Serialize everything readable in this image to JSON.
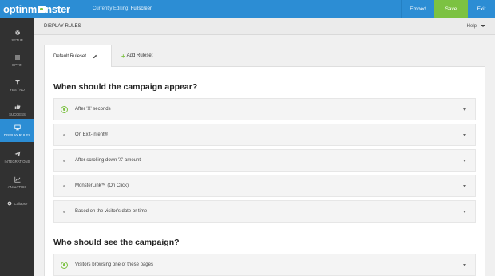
{
  "topbar": {
    "logo_left": "optinm",
    "logo_right": "nster",
    "editing_label": "Currently Editing:",
    "editing_value": "Fullscreen",
    "embed_label": "Embed",
    "save_label": "Save",
    "exit_label": "Exit",
    "colors": {
      "bar": "#2c8dd4",
      "save": "#7cc242"
    }
  },
  "sidebar": {
    "items": [
      {
        "label": "SETUP",
        "icon": "gear-icon"
      },
      {
        "label": "OPTIN",
        "icon": "menu-lines-icon"
      },
      {
        "label": "YES / NO",
        "icon": "filter-icon"
      },
      {
        "label": "SUCCESS",
        "icon": "thumbs-up-icon"
      },
      {
        "label": "DISPLAY RULES",
        "icon": "monitor-icon"
      },
      {
        "label": "INTEGRATIONS",
        "icon": "paper-plane-icon"
      },
      {
        "label": "ANALYTICS",
        "icon": "line-chart-icon"
      }
    ],
    "collapse_label": "Collapse",
    "active": "DISPLAY RULES"
  },
  "header": {
    "title": "DISPLAY RULES",
    "help_label": "Help"
  },
  "tabs": {
    "ruleset_label": "Default Ruleset",
    "add_label": "Add Ruleset"
  },
  "section1": {
    "heading": "When should the campaign appear?",
    "rules": [
      {
        "label": "After 'X' seconds",
        "selected": true
      },
      {
        "label": "On Exit-Intent®",
        "selected": false
      },
      {
        "label": "After scrolling down 'X' amount",
        "selected": false
      },
      {
        "label": "MonsterLink™ (On Click)",
        "selected": false
      },
      {
        "label": "Based on the visitor's date or time",
        "selected": false
      }
    ]
  },
  "section2": {
    "heading": "Who should see the campaign?",
    "rules": [
      {
        "label": "Visitors browsing one of these pages",
        "selected": true
      }
    ]
  }
}
